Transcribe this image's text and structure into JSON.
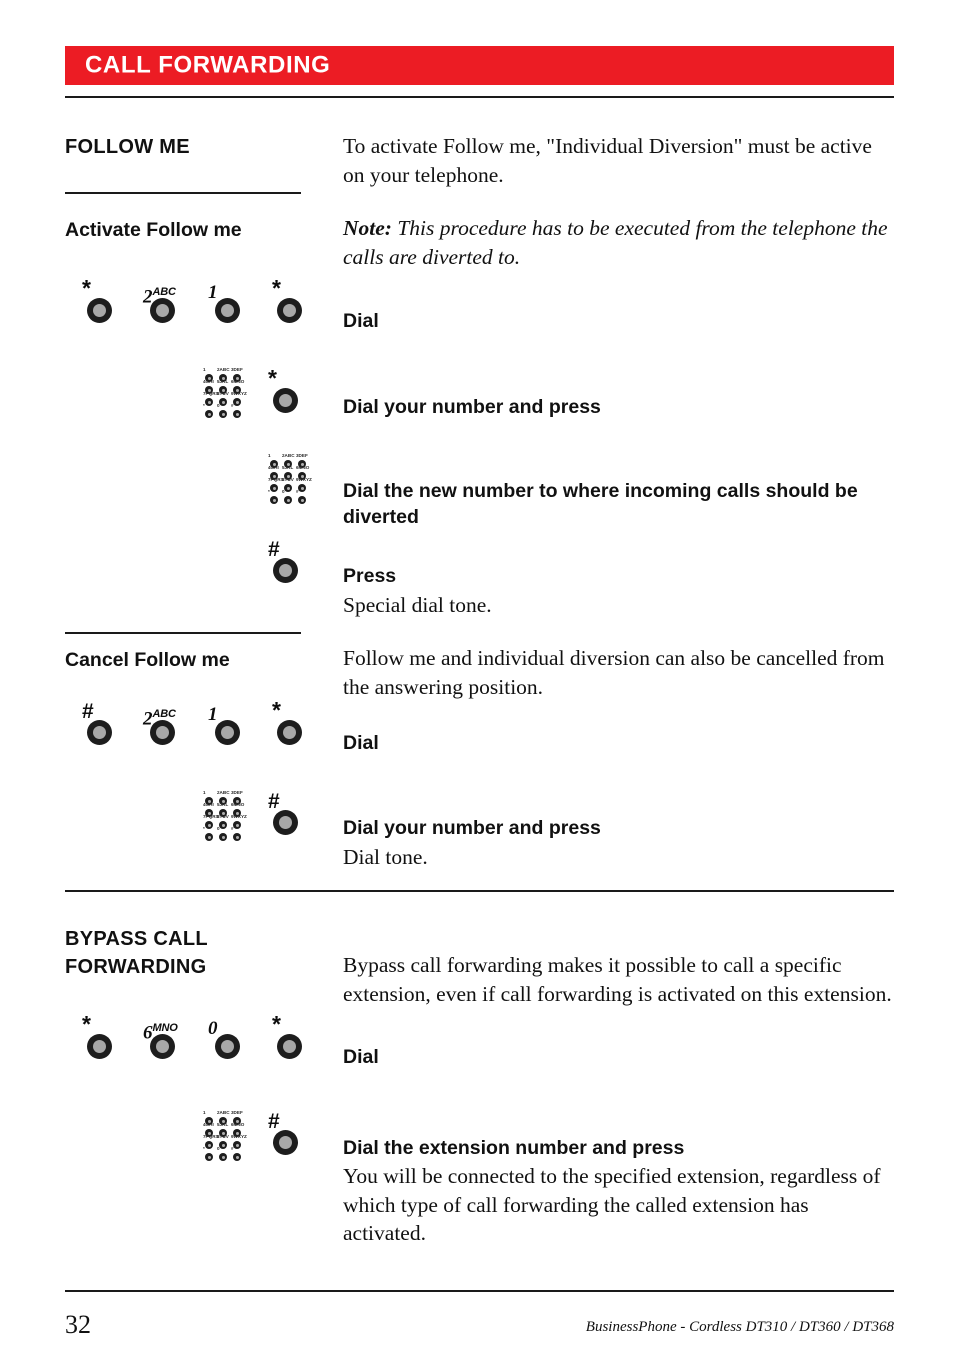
{
  "document": {
    "banner_title": "CALL FORWARDING",
    "banner_color": "#ec1c24",
    "page_number": "32",
    "footer_note": "BusinessPhone - Cordless DT310 / DT360 / DT368"
  },
  "sections": {
    "follow_me": {
      "heading": "FOLLOW ME",
      "intro": "To activate Follow me, \"Individual Diversion\" must be active on your telephone."
    },
    "activate": {
      "heading": "Activate Follow me",
      "note_label": "Note:",
      "note_text": " This procedure has to be executed from the telephone the calls are diverted to.",
      "steps": [
        {
          "label": "Dial",
          "sub": ""
        },
        {
          "label": "Dial your number and press",
          "sub": ""
        },
        {
          "label": "Dial the new number to where incoming calls should be diverted",
          "sub": ""
        },
        {
          "label": "Press",
          "sub": "Special dial tone."
        }
      ]
    },
    "cancel": {
      "heading": "Cancel Follow me",
      "intro": "Follow me and individual diversion can also be cancelled from the answering position.",
      "steps": [
        {
          "label": "Dial",
          "sub": ""
        },
        {
          "label": "Dial your number and press",
          "sub": "Dial tone."
        }
      ]
    },
    "bypass": {
      "heading_line1": "BYPASS CALL",
      "heading_line2": "FORWARDING",
      "intro": "Bypass call forwarding makes it possible to call a specific extension, even if call forwarding is activated on this extension.",
      "steps": [
        {
          "label": "Dial",
          "sub": ""
        },
        {
          "label": "Dial the extension number and press",
          "sub": "You will be connected to the specified extension, regardless of which type of call forwarding the called extension has activated."
        }
      ]
    }
  },
  "key_sequences": {
    "activate_dial": [
      {
        "main": "*",
        "sup": "",
        "type": "symbol"
      },
      {
        "main": "2",
        "sup": "ABC",
        "type": "digit"
      },
      {
        "main": "1",
        "sup": "",
        "type": "digit"
      },
      {
        "main": "*",
        "sup": "",
        "type": "symbol"
      }
    ],
    "activate_press_star": [
      {
        "main": "*",
        "sup": "",
        "type": "symbol"
      }
    ],
    "activate_press_hash": [
      {
        "main": "#",
        "sup": "",
        "type": "symbol"
      }
    ],
    "cancel_dial": [
      {
        "main": "#",
        "sup": "",
        "type": "symbol"
      },
      {
        "main": "2",
        "sup": "ABC",
        "type": "digit"
      },
      {
        "main": "1",
        "sup": "",
        "type": "digit"
      },
      {
        "main": "*",
        "sup": "",
        "type": "symbol"
      }
    ],
    "cancel_press_hash": [
      {
        "main": "#",
        "sup": "",
        "type": "symbol"
      }
    ],
    "bypass_dial": [
      {
        "main": "*",
        "sup": "",
        "type": "symbol"
      },
      {
        "main": "6",
        "sup": "MNO",
        "type": "digit"
      },
      {
        "main": "0",
        "sup": "",
        "type": "digit"
      },
      {
        "main": "*",
        "sup": "",
        "type": "symbol"
      }
    ],
    "bypass_press_hash": [
      {
        "main": "#",
        "sup": "",
        "type": "symbol"
      }
    ]
  },
  "keypad_icon": {
    "name": "dial-keypad-icon",
    "keys": [
      "1",
      "2ABC",
      "3DEF",
      "4GHI",
      "5JKL",
      "6MNO",
      "7PQRS",
      "8TUV",
      "9WXYZ",
      "*",
      "0",
      "#"
    ]
  }
}
